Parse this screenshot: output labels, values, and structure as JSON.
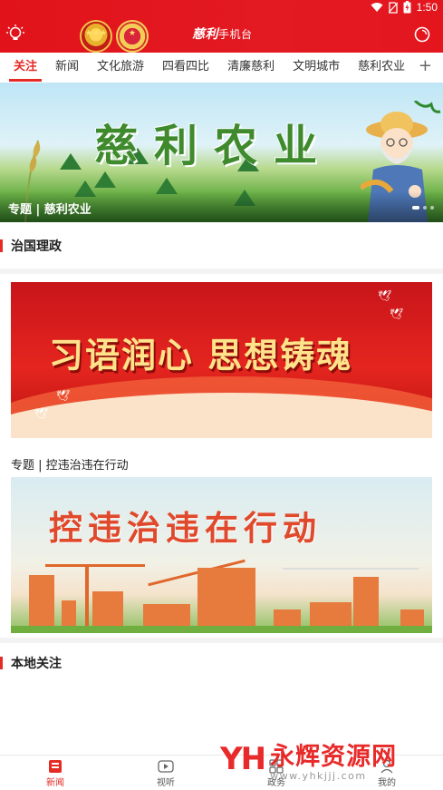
{
  "status_bar": {
    "time": "1:50"
  },
  "header": {
    "title_big": "慈利",
    "title_small": "手机台"
  },
  "tabs": [
    "关注",
    "新闻",
    "文化旅游",
    "四看四比",
    "清廉慈利",
    "文明城市",
    "慈利农业"
  ],
  "tabs_more": "+",
  "banner": {
    "title": "慈利农业",
    "caption": "专题 | 慈利农业"
  },
  "sections": {
    "governance": "治国理政",
    "local": "本地关注"
  },
  "cards": {
    "red_card_text": "习语润心 思想铸魂",
    "topic_label": "专题 | 控违治违在行动",
    "build_card_text": "控违治违在行动"
  },
  "bottom_nav": [
    {
      "label": "新闻",
      "icon": "news-icon",
      "active": true
    },
    {
      "label": "视听",
      "icon": "video-icon",
      "active": false
    },
    {
      "label": "政务",
      "icon": "government-icon",
      "active": false
    },
    {
      "label": "我的",
      "icon": "profile-icon",
      "active": false
    }
  ],
  "watermark": {
    "logo": "YH",
    "name": "永辉资源网",
    "url": "www.yhkjjj.com"
  },
  "colors": {
    "brand_red": "#e52b25",
    "header_red": "#e3161e"
  }
}
